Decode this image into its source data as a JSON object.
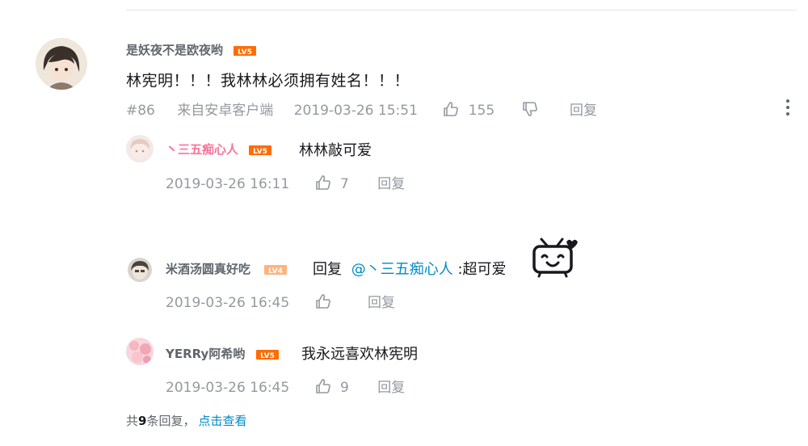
{
  "comment": {
    "username": "是妖夜不是欧夜哟",
    "level": "LV5",
    "content": "林宪明！！！我林林必须拥有姓名！！！",
    "floor": "#86",
    "source": "来自安卓客户端",
    "time": "2019-03-26 15:51",
    "likes": "155",
    "reply_label": "回复"
  },
  "replies": [
    {
      "username": "丶三五痴心人",
      "level": "LV5",
      "name_color": "#fb7299",
      "content": "林林敲可爱",
      "time": "2019-03-26 16:11",
      "likes": "7",
      "reply_label": "回复"
    },
    {
      "username": "米酒汤圆真好吃",
      "level": "LV4",
      "name_color": "#61666d",
      "reply_prefix": "回复",
      "mention": "@丶三五痴心人",
      "content": ":超可爱",
      "sticker": "tv-heart-icon",
      "time": "2019-03-26 16:45",
      "likes": "",
      "reply_label": "回复"
    },
    {
      "username": "YERRy阿希哟",
      "level": "LV5",
      "name_color": "#61666d",
      "content": "我永远喜欢林宪明",
      "time": "2019-03-26 16:45",
      "likes": "9",
      "reply_label": "回复"
    }
  ],
  "footer": {
    "prefix": "共",
    "count": "9",
    "suffix": "条回复，",
    "link": "点击查看"
  },
  "colors": {
    "lv5": "#ff6c00",
    "lv4": "#ffb37c",
    "link": "#008ac5",
    "meta": "#9499a0"
  }
}
